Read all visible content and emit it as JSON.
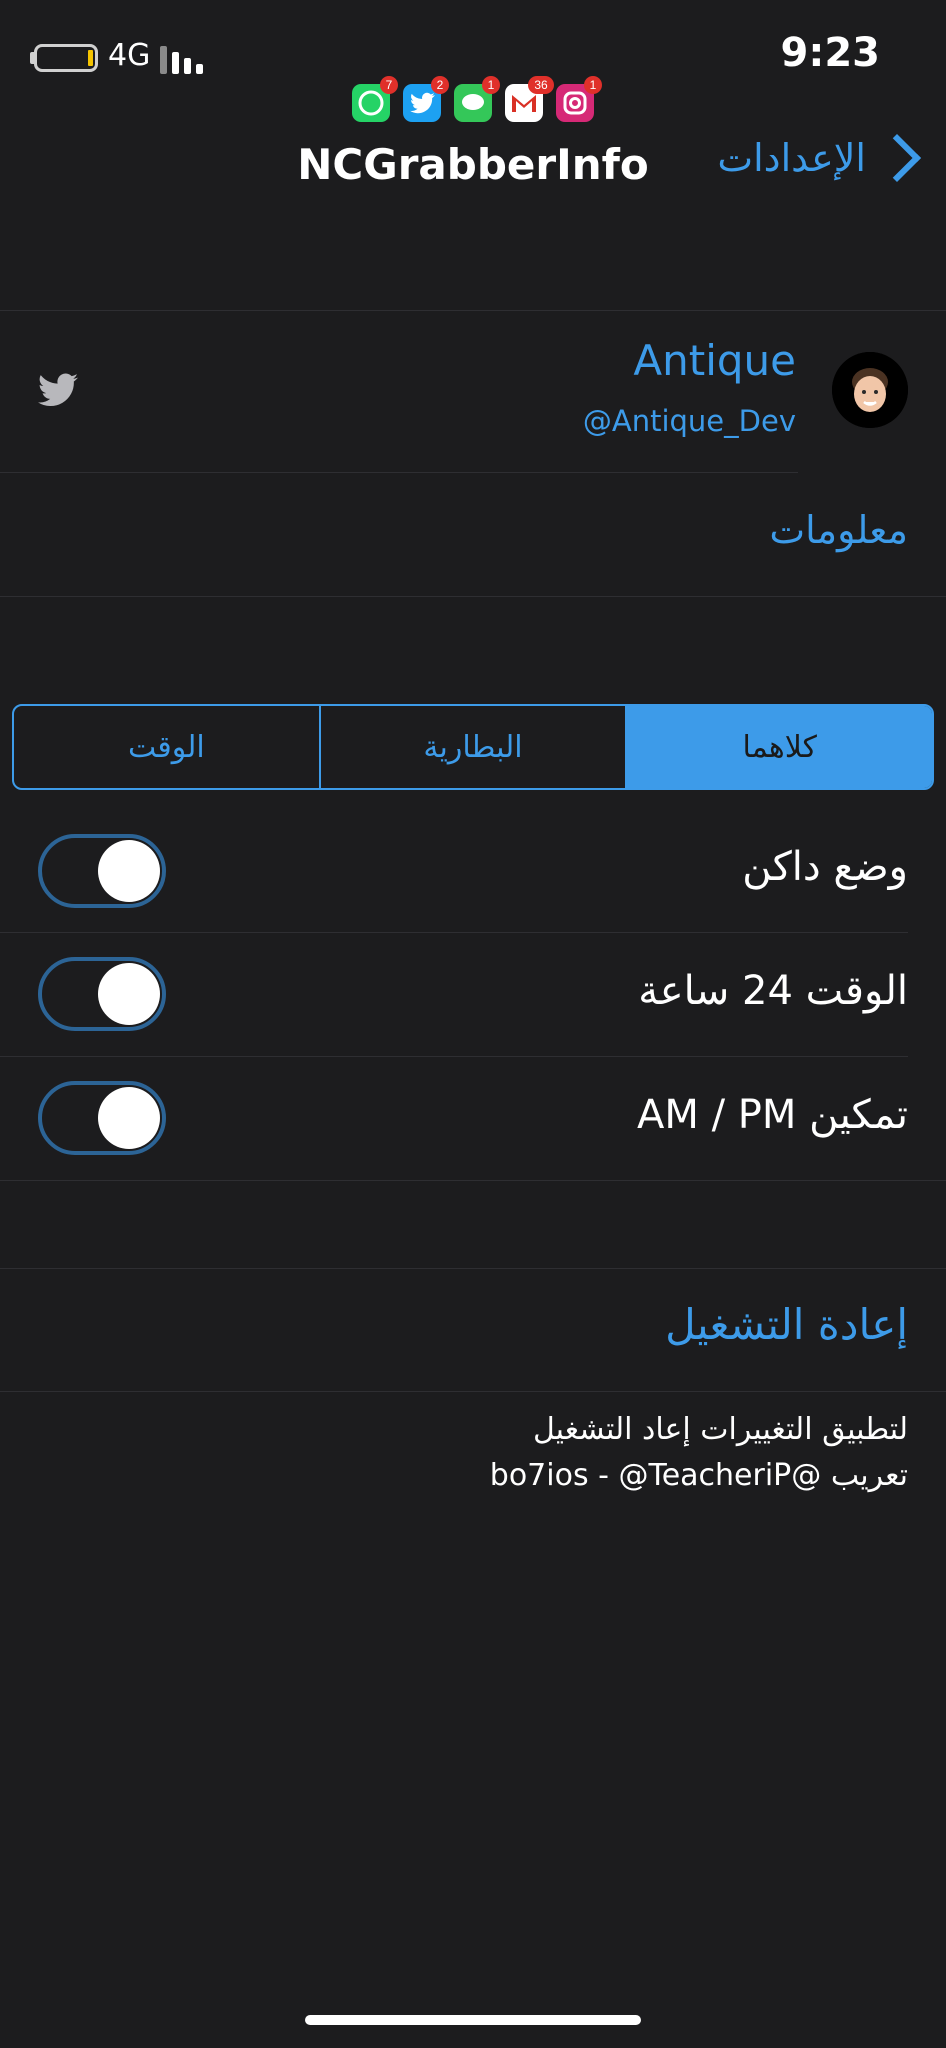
{
  "status_bar": {
    "network": "4G",
    "time": "9:23"
  },
  "notifications": [
    {
      "icon": "whatsapp-icon",
      "color": "#25d366",
      "count": "7"
    },
    {
      "icon": "twitter-icon",
      "color": "#1da1f2",
      "count": "2"
    },
    {
      "icon": "messages-icon",
      "color": "#34c759",
      "count": "1"
    },
    {
      "icon": "gmail-icon",
      "color": "#ffffff",
      "count": "36"
    },
    {
      "icon": "instagram-icon",
      "color": "#d62976",
      "count": "1"
    }
  ],
  "nav": {
    "title": "NCGrabberInfo",
    "back_label": "الإعدادات"
  },
  "developer": {
    "name": "Antique",
    "handle": "@Antique_Dev"
  },
  "info_label": "معلومات",
  "segments": [
    {
      "label": "الوقت",
      "selected": false
    },
    {
      "label": "البطارية",
      "selected": false
    },
    {
      "label": "كلاهما",
      "selected": true
    }
  ],
  "settings": [
    {
      "label": "وضع داكن",
      "on": true
    },
    {
      "label": "الوقت 24 ساعة",
      "on": true
    },
    {
      "label": "تمكين AM / PM",
      "on": true
    }
  ],
  "respring_label": "إعادة التشغيل",
  "footer": {
    "line1": "لتطبيق التغييرات إعاد التشغيل",
    "line2": "تعريب @bo7ios - @TeacheriP"
  },
  "colors": {
    "accent": "#3d9be9",
    "background": "#1c1c1e"
  }
}
